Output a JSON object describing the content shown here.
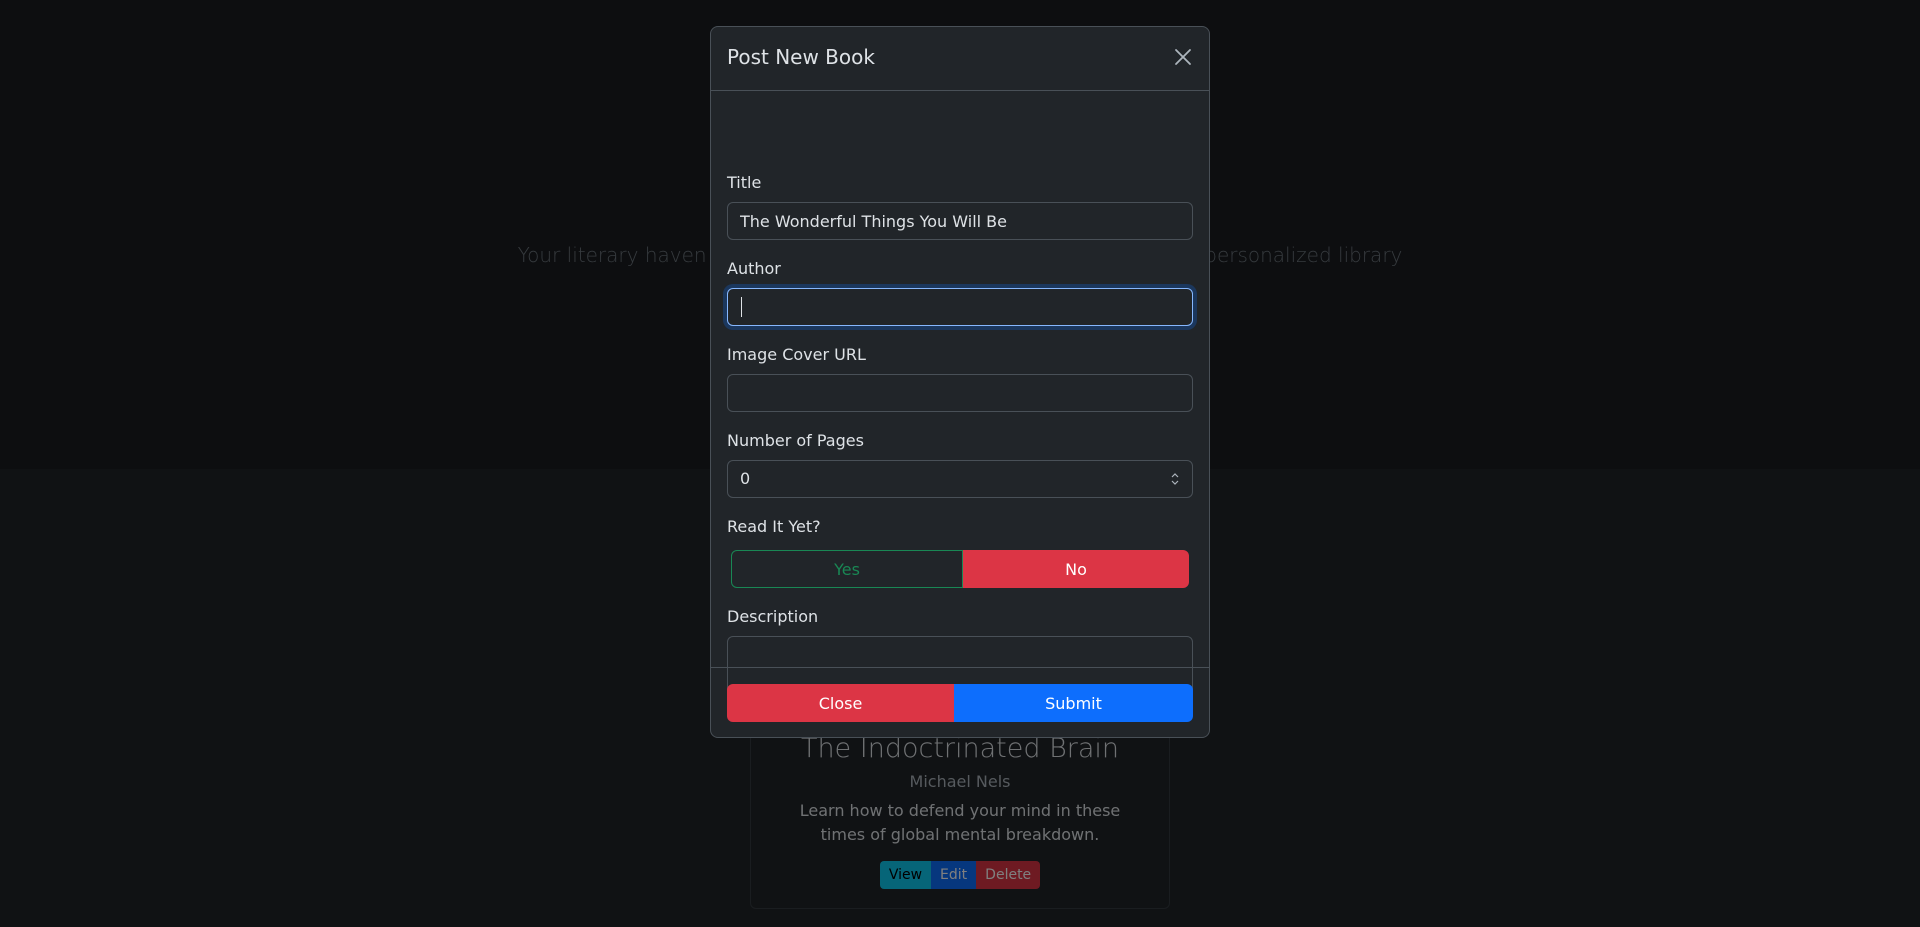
{
  "background": {
    "tagline": "Your literary haven for exploring and tracking your favorite books. A personalized library",
    "book_card": {
      "title": "The Indoctrinated Brain",
      "author": "Michael Nels",
      "description": "Learn how to defend your mind in these times of global mental breakdown.",
      "view_label": "View",
      "edit_label": "Edit",
      "delete_label": "Delete"
    }
  },
  "modal": {
    "title": "Post New Book",
    "fields": {
      "title_label": "Title",
      "title_value": "The Wonderful Things You Will Be",
      "author_label": "Author",
      "author_value": "",
      "cover_label": "Image Cover URL",
      "cover_value": "",
      "pages_label": "Number of Pages",
      "pages_value": "0",
      "read_label": "Read It Yet?",
      "read_yes": "Yes",
      "read_no": "No",
      "read_selected": "No",
      "description_label": "Description",
      "description_value": ""
    },
    "footer": {
      "close_label": "Close",
      "submit_label": "Submit"
    }
  },
  "colors": {
    "danger": "#dc3545",
    "primary": "#0d6efd",
    "success": "#198754",
    "info": "#0dcaf0"
  }
}
